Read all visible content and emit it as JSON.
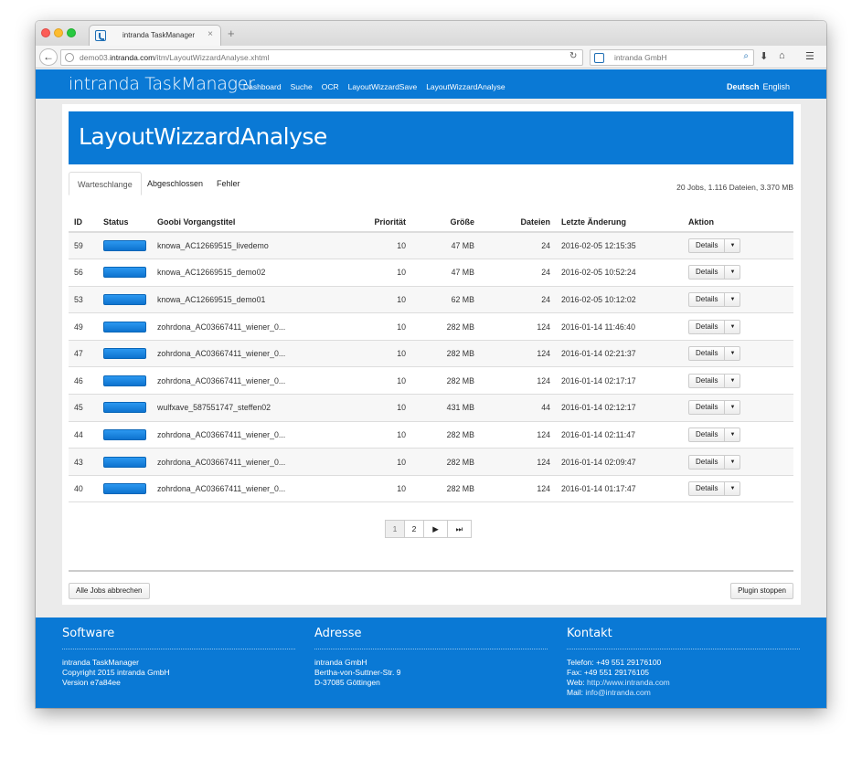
{
  "browser": {
    "tab_title": "intranda TaskManager",
    "tab_close": "×",
    "new_tab": "+",
    "url_prefix": "demo03.",
    "url_host": "intranda.com",
    "url_path": "/itm/LayoutWizzardAnalyse.xhtml",
    "search_text": "intranda GmbH"
  },
  "app": {
    "brand": "intranda TaskManager",
    "menu": [
      "Dashboard",
      "Suche",
      "OCR",
      "LayoutWizzardSave",
      "LayoutWizzardAnalyse"
    ],
    "lang_active": "Deutsch",
    "lang_other": "English"
  },
  "page": {
    "title": "LayoutWizzardAnalyse",
    "tabs": [
      "Warteschlange",
      "Abgeschlossen",
      "Fehler"
    ],
    "summary": "20 Jobs, 1.116 Dateien, 3.370 MB"
  },
  "table": {
    "headers": [
      "ID",
      "Status",
      "Goobi Vorgangstitel",
      "Priorität",
      "Größe",
      "Dateien",
      "Letzte Änderung",
      "Aktion"
    ],
    "rows": [
      {
        "id": "59",
        "title": "knowa_AC12669515_livedemo",
        "priority": "10",
        "size": "47 MB",
        "files": "24",
        "changed": "2016-02-05 12:15:35"
      },
      {
        "id": "56",
        "title": "knowa_AC12669515_demo02",
        "priority": "10",
        "size": "47 MB",
        "files": "24",
        "changed": "2016-02-05 10:52:24"
      },
      {
        "id": "53",
        "title": "knowa_AC12669515_demo01",
        "priority": "10",
        "size": "62 MB",
        "files": "24",
        "changed": "2016-02-05 10:12:02"
      },
      {
        "id": "49",
        "title": "zohrdona_AC03667411_wiener_0...",
        "priority": "10",
        "size": "282 MB",
        "files": "124",
        "changed": "2016-01-14 11:46:40"
      },
      {
        "id": "47",
        "title": "zohrdona_AC03667411_wiener_0...",
        "priority": "10",
        "size": "282 MB",
        "files": "124",
        "changed": "2016-01-14 02:21:37"
      },
      {
        "id": "46",
        "title": "zohrdona_AC03667411_wiener_0...",
        "priority": "10",
        "size": "282 MB",
        "files": "124",
        "changed": "2016-01-14 02:17:17"
      },
      {
        "id": "45",
        "title": "wulfxave_587551747_steffen02",
        "priority": "10",
        "size": "431 MB",
        "files": "44",
        "changed": "2016-01-14 02:12:17"
      },
      {
        "id": "44",
        "title": "zohrdona_AC03667411_wiener_0...",
        "priority": "10",
        "size": "282 MB",
        "files": "124",
        "changed": "2016-01-14 02:11:47"
      },
      {
        "id": "43",
        "title": "zohrdona_AC03667411_wiener_0...",
        "priority": "10",
        "size": "282 MB",
        "files": "124",
        "changed": "2016-01-14 02:09:47"
      },
      {
        "id": "40",
        "title": "zohrdona_AC03667411_wiener_0...",
        "priority": "10",
        "size": "282 MB",
        "files": "124",
        "changed": "2016-01-14 01:17:47"
      }
    ],
    "details_label": "Details"
  },
  "pagination": {
    "pages": [
      "1",
      "2"
    ],
    "current": "1"
  },
  "actions": {
    "abort_all": "Alle Jobs abbrechen",
    "stop_plugin": "Plugin stoppen"
  },
  "footer": {
    "software": {
      "heading": "Software",
      "lines": [
        "intranda TaskManager",
        "Copyright 2015 intranda GmbH",
        "Version e7a84ee"
      ]
    },
    "address": {
      "heading": "Adresse",
      "lines": [
        "intranda GmbH",
        "Bertha-von-Suttner-Str. 9",
        "D-37085 Göttingen"
      ]
    },
    "contact": {
      "heading": "Kontakt",
      "phone": "Telefon: +49 551 29176100",
      "fax": "Fax: +49 551 29176105",
      "web_label": "Web: ",
      "web": "http://www.intranda.com",
      "mail_label": "Mail: ",
      "mail": "info@intranda.com"
    }
  }
}
